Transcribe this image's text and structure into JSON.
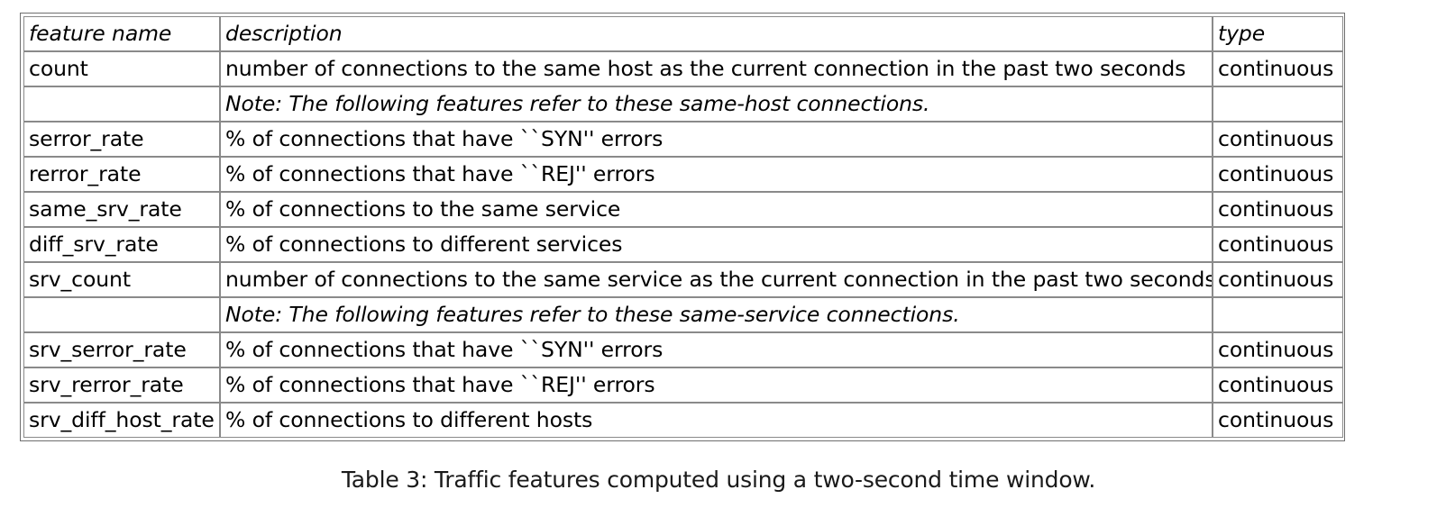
{
  "table": {
    "columns": [
      {
        "key": "feature_name",
        "header": "feature name"
      },
      {
        "key": "description",
        "header": "description"
      },
      {
        "key": "type",
        "header": "type"
      }
    ],
    "rows": [
      {
        "kind": "data",
        "feature_name": "count",
        "description": "number of connections to the same host as the current connection in the past two seconds",
        "type": "continuous"
      },
      {
        "kind": "note",
        "feature_name": "",
        "description": "Note: The following  features refer to these same-host connections.",
        "type": ""
      },
      {
        "kind": "data",
        "feature_name": "serror_rate",
        "description": "% of connections that have ``SYN'' errors",
        "type": "continuous"
      },
      {
        "kind": "data",
        "feature_name": "rerror_rate",
        "description": "% of connections that have ``REJ'' errors",
        "type": "continuous"
      },
      {
        "kind": "data",
        "feature_name": "same_srv_rate",
        "description": "% of connections to the same service",
        "type": "continuous"
      },
      {
        "kind": "data",
        "feature_name": "diff_srv_rate",
        "description": "% of connections to different services",
        "type": "continuous"
      },
      {
        "kind": "data",
        "feature_name": "srv_count",
        "description": "number of connections to the same service as the current connection in the past two seconds",
        "type": "continuous"
      },
      {
        "kind": "note",
        "feature_name": "",
        "description": "Note: The following features refer to these same-service connections.",
        "type": ""
      },
      {
        "kind": "data",
        "feature_name": "srv_serror_rate",
        "description": "% of connections that have ``SYN'' errors",
        "type": "continuous"
      },
      {
        "kind": "data",
        "feature_name": "srv_rerror_rate",
        "description": "% of connections that have ``REJ'' errors",
        "type": "continuous"
      },
      {
        "kind": "data",
        "feature_name": "srv_diff_host_rate",
        "description": "% of connections to different hosts",
        "type": "continuous"
      }
    ]
  },
  "caption": "Table 3: Traffic features computed using a two-second time window."
}
